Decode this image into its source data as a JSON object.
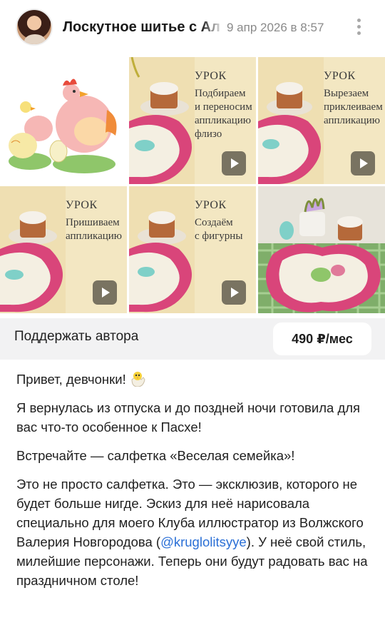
{
  "header": {
    "group_name": "Лоскутное шитье с Ал",
    "date": "9 апр 2026 в 8:57",
    "more_icon": "more-vertical-icon"
  },
  "gallery": {
    "tiles": [
      {
        "kind": "illustration",
        "icon": "hen-chick-illustration"
      },
      {
        "kind": "video",
        "title": "УРОК",
        "lines": [
          "Подбираем",
          "и переносим",
          "аппликацию",
          "флизо"
        ]
      },
      {
        "kind": "video",
        "title": "УРОК",
        "lines": [
          "Вырезаем",
          "приклеиваем",
          "аппликацию"
        ]
      },
      {
        "kind": "video",
        "title": "УРОК",
        "lines": [
          "Пришиваем",
          "аппликацию"
        ]
      },
      {
        "kind": "video",
        "title": "УРОК",
        "lines": [
          "Создаём",
          "с фигурны"
        ]
      },
      {
        "kind": "photo"
      }
    ],
    "play_icon": "play-icon"
  },
  "support": {
    "label": "Поддержать автора",
    "price": "490 ₽/мес"
  },
  "post": {
    "p1": "Привет, девчонки!",
    "p2": "Я вернулась из отпуска и до поздней ночи готовила для вас что-то особенное к Пасхе!",
    "p3": "Встречайте — салфетка «Веселая семейка»!",
    "p4_a": "Это не просто салфетка. Это — эксклюзив, которого не будет больше нигде. Эскиз для неё нарисовала специально для моего Клуба иллюстратор из Волжского Валерия Новгородова (",
    "p4_mention": "@kruglolitsyye",
    "p4_b": "). У неё свой стиль, милейшие персонажи. Теперь они будут радовать вас на праздничном столе!",
    "emoji": "hatching-chick-emoji"
  },
  "colors": {
    "accent_link": "#2a6fd6",
    "support_bg": "#f2f2f3",
    "tile_bg": "#f3e7c2",
    "napkin_pink": "#d9457a"
  }
}
